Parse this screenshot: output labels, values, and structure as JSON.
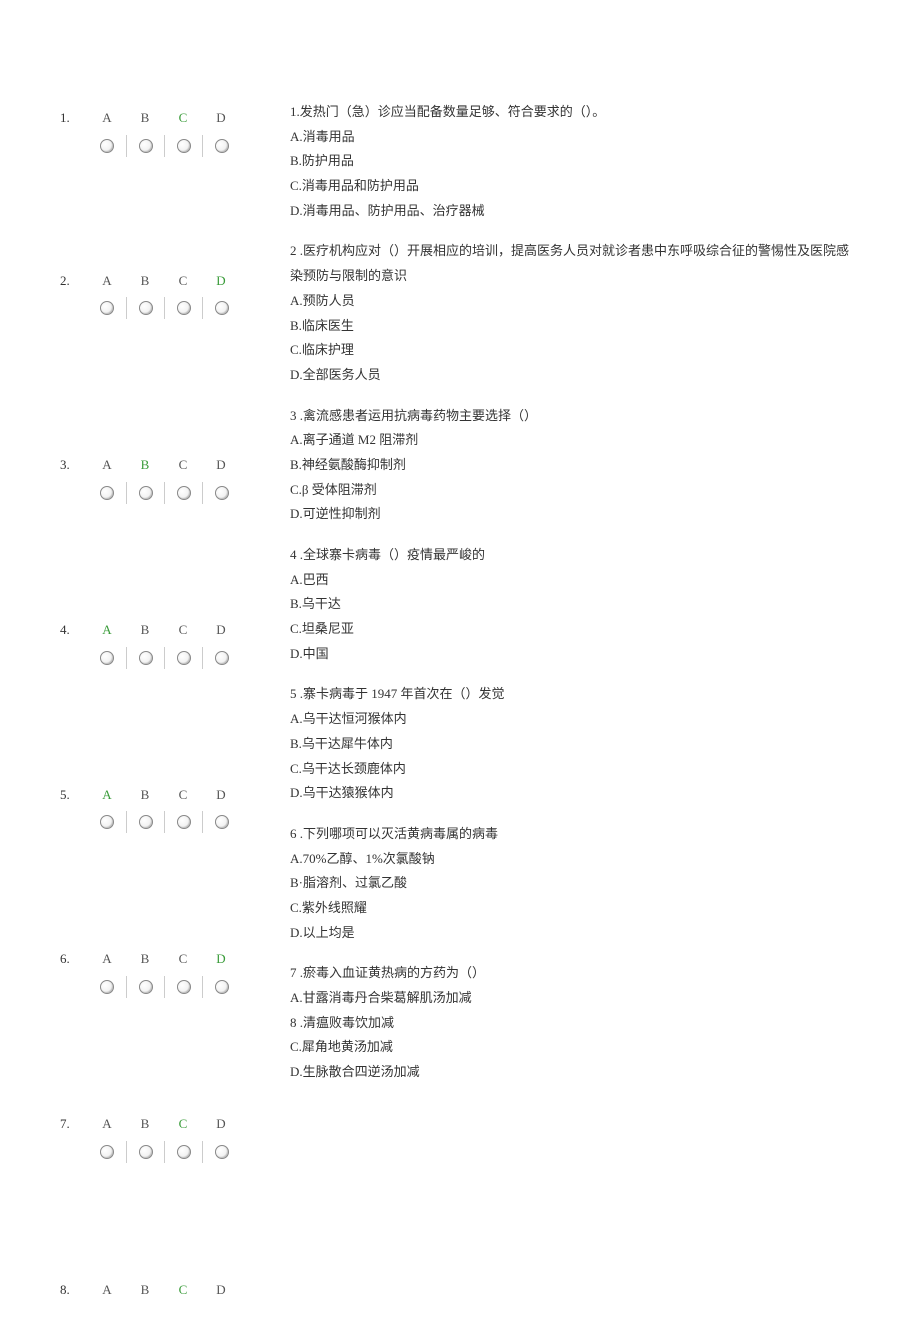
{
  "letters": [
    "A",
    "B",
    "C",
    "D"
  ],
  "questions": [
    {
      "num": "1.",
      "correct": 2,
      "answerSpacer": 106,
      "stem": "1.发热门（急）诊应当配备数量足够、符合要求的（）。",
      "opts": [
        "A.消毒用品",
        "B.防护用品",
        "C.消毒用品和防护用品",
        "D.消毒用品、防护用品、治疗器械"
      ]
    },
    {
      "num": "2.",
      "correct": 3,
      "answerSpacer": 128,
      "stem": "2  .医疗机构应对（）开展相应的培训，提高医务人员对就诊者患中东呼吸综合征的警惕性及医院感染预防与限制的意识",
      "opts": [
        "A.预防人员",
        "B.临床医生",
        "C.临床护理",
        "D.全部医务人员"
      ]
    },
    {
      "num": "3.",
      "correct": 1,
      "answerSpacer": 108,
      "stem": "3  .禽流感患者运用抗病毒药物主要选择（）",
      "opts": [
        "A.离子通道 M2 阻滞剂",
        "B.神经氨酸酶抑制剂",
        "C.β 受体阻滞剂",
        "D.可逆性抑制剂"
      ]
    },
    {
      "num": "4.",
      "correct": 0,
      "answerSpacer": 108,
      "stem": "4  .全球寨卡病毒（）疫情最严峻的",
      "opts": [
        "A.巴西",
        "B.乌干达",
        "C.坦桑尼亚",
        "D.中国"
      ]
    },
    {
      "num": "5.",
      "correct": 0,
      "answerSpacer": 108,
      "stem": "5  .寨卡病毒于 1947 年首次在（）发觉",
      "opts": [
        "A.乌干达恒河猴体内",
        "B.乌干达犀牛体内",
        "C.乌干达长颈鹿体内",
        "D.乌干达猿猴体内"
      ]
    },
    {
      "num": "6.",
      "correct": 3,
      "answerSpacer": 108,
      "stem": "6  .下列哪项可以灭活黄病毒属的病毒",
      "opts": [
        "A.70%乙醇、1%次氯酸钠",
        "B·脂溶剂、过氯乙酸",
        "C.紫外线照耀",
        "D.以上均是"
      ]
    },
    {
      "num": "7.",
      "correct": 2,
      "answerSpacer": 109,
      "stem": "7  .瘀毒入血证黄热病的方药为（）",
      "opts": [
        "A.甘露消毒丹合柴葛解肌汤加减",
        "8  .清瘟败毒饮加减",
        "C.犀角地黄汤加减",
        "D.生脉散合四逆汤加减"
      ]
    },
    {
      "num": "8.",
      "correct": 2,
      "answerSpacer": 0,
      "stem": null,
      "opts": []
    }
  ]
}
